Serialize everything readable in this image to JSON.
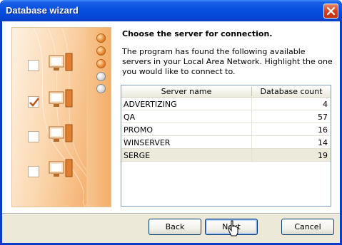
{
  "window": {
    "title": "Database wizard"
  },
  "steps": {
    "indicators": [
      "on",
      "on",
      "on",
      "off",
      "off"
    ],
    "checkboxes": [
      false,
      true,
      false,
      false
    ]
  },
  "main": {
    "heading": "Choose the server for connection.",
    "description": "The program has found the following available servers in your Local Area Network. Highlight the one you would like to connect to."
  },
  "server_table": {
    "columns": [
      "Server name",
      "Database count"
    ],
    "rows": [
      {
        "name": "ADVERTIZING",
        "count": "4"
      },
      {
        "name": "QA",
        "count": "57"
      },
      {
        "name": "PROMO",
        "count": "16"
      },
      {
        "name": "WINSERVER",
        "count": "14"
      },
      {
        "name": "SERGE",
        "count": "19"
      }
    ],
    "selected_row": "SERGE"
  },
  "buttons": {
    "back": "Back",
    "next": "Next",
    "cancel": "Cancel"
  },
  "colors": {
    "titlebar": "#0a52e0",
    "accent": "#e9872d",
    "selection": "#ebeadb"
  }
}
